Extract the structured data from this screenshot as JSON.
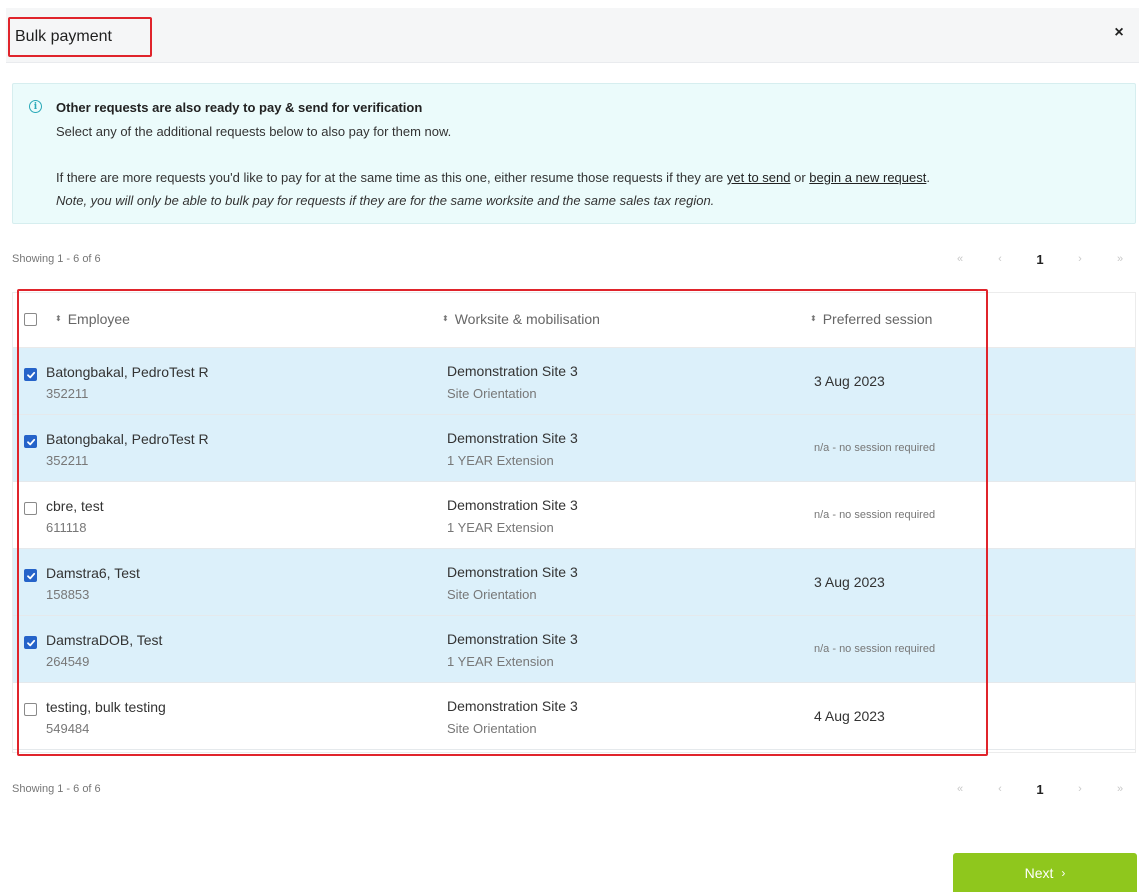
{
  "dialog": {
    "title": "Bulk payment",
    "close_glyph": "×"
  },
  "info": {
    "icon_glyph": "i",
    "heading": "Other requests are also ready to pay & send for verification",
    "line1": "Select any of the additional requests below to also pay for them now.",
    "line2_pre": "If there are more requests you'd like to pay for at the same time as this one, either resume those requests if they are ",
    "link_yet_to_send": "yet to send",
    "line2_mid": " or ",
    "link_begin_new": "begin a new request",
    "line2_post": ".",
    "note": "Note, you will only be able to bulk pay for requests if they are for the same worksite and the same sales tax region."
  },
  "pagination": {
    "showing_text": "Showing 1 - 6 of 6",
    "first": "«",
    "prev": "‹",
    "current": "1",
    "next": "›",
    "last": "»"
  },
  "table": {
    "sort_glyph": "⬍",
    "columns": {
      "employee": "Employee",
      "worksite": "Worksite & mobilisation",
      "session": "Preferred session"
    },
    "header_checked": false,
    "rows": [
      {
        "checked": true,
        "name": "Batongbakal, PedroTest R",
        "id": "352211",
        "site": "Demonstration Site 3",
        "mobilisation": "Site Orientation",
        "session": "3 Aug 2023",
        "session_na": false
      },
      {
        "checked": true,
        "name": "Batongbakal, PedroTest R",
        "id": "352211",
        "site": "Demonstration Site 3",
        "mobilisation": "1 YEAR Extension",
        "session": "n/a - no session required",
        "session_na": true
      },
      {
        "checked": false,
        "name": "cbre, test",
        "id": "611118",
        "site": "Demonstration Site 3",
        "mobilisation": "1 YEAR Extension",
        "session": "n/a - no session required",
        "session_na": true
      },
      {
        "checked": true,
        "name": "Damstra6, Test",
        "id": "158853",
        "site": "Demonstration Site 3",
        "mobilisation": "Site Orientation",
        "session": "3 Aug 2023",
        "session_na": false
      },
      {
        "checked": true,
        "name": "DamstraDOB, Test",
        "id": "264549",
        "site": "Demonstration Site 3",
        "mobilisation": "1 YEAR Extension",
        "session": "n/a - no session required",
        "session_na": true
      },
      {
        "checked": false,
        "name": "testing, bulk testing",
        "id": "549484",
        "site": "Demonstration Site 3",
        "mobilisation": "Site Orientation",
        "session": "4 Aug 2023",
        "session_na": false
      }
    ]
  },
  "footer": {
    "next_label": "Next",
    "next_chevron": "›"
  },
  "colors": {
    "selected_row": "#dcf0fa",
    "highlight_red": "#e0242b",
    "next_green": "#8fc71d",
    "checkbox_blue": "#2563c9",
    "info_bg": "#ebfbfb"
  }
}
